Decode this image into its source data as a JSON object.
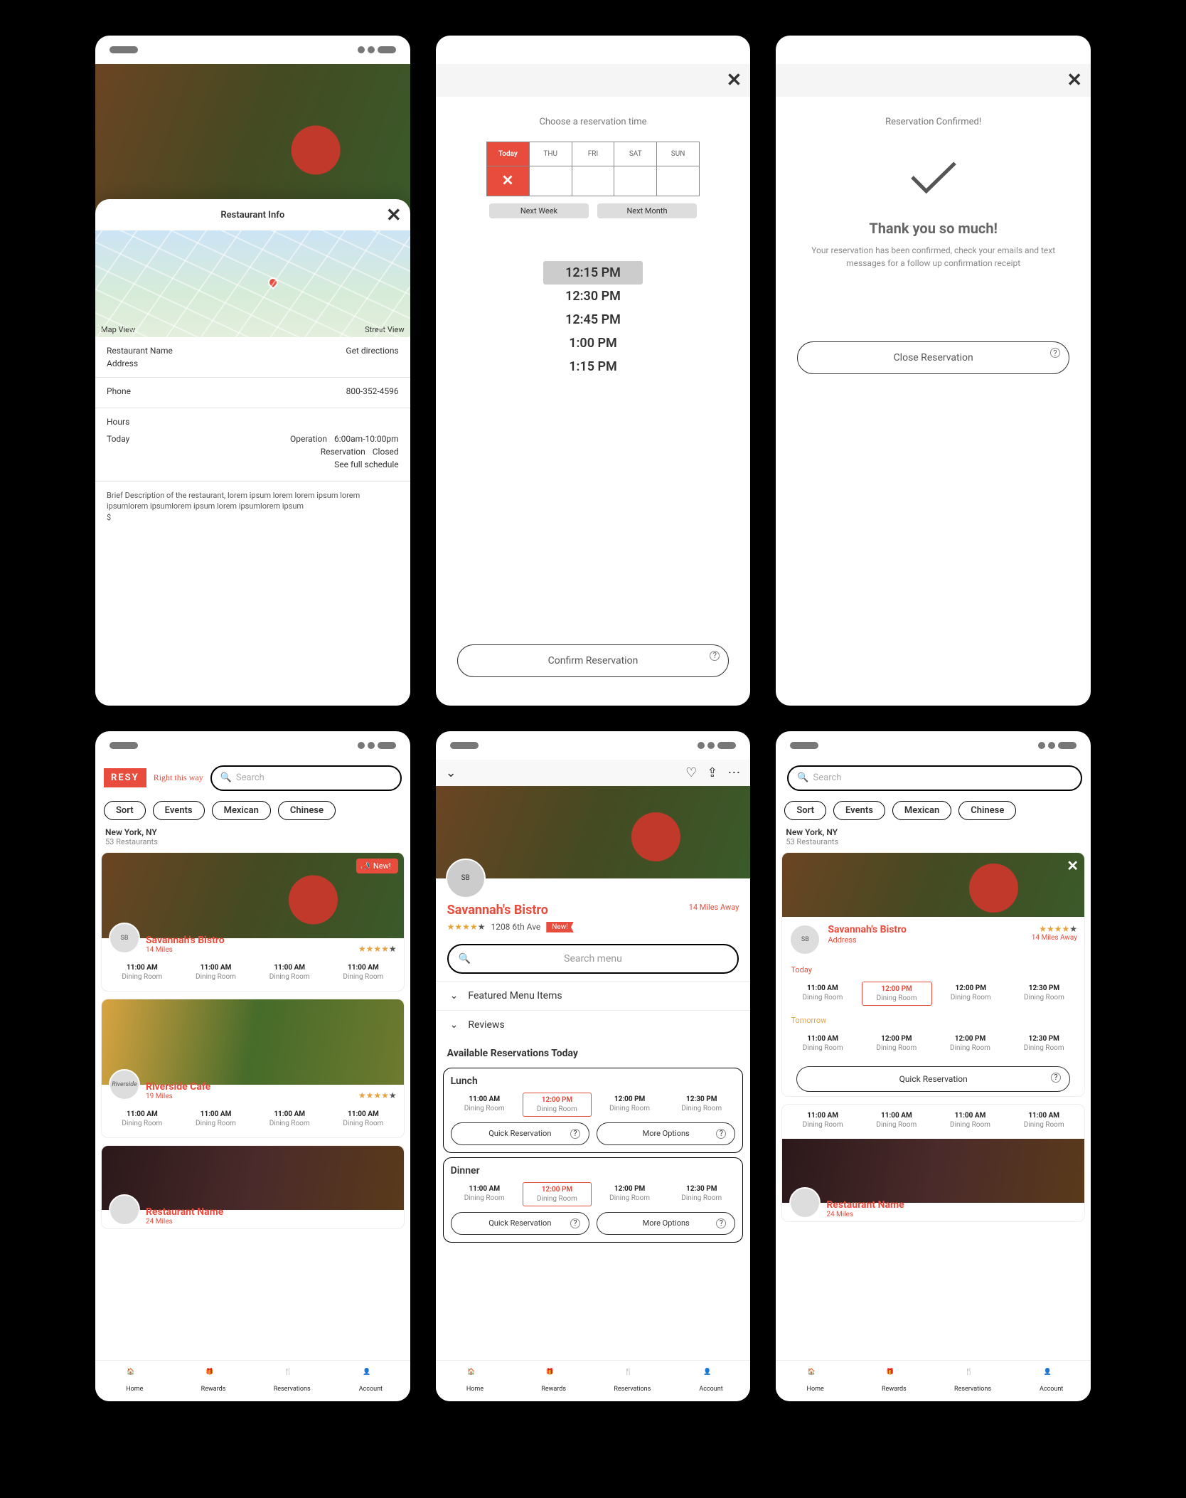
{
  "screen1": {
    "sheet_title": "Restaurant Info",
    "map_view": "Map View",
    "street_view": "Street View",
    "name_label": "Restaurant Name",
    "address_label": "Address",
    "get_directions": "Get directions",
    "phone_label": "Phone",
    "phone_value": "800-352-4596",
    "hours_label": "Hours",
    "today_label": "Today",
    "operation_label": "Operation",
    "operation_value": "6:00am-10:00pm",
    "reservation_label": "Reservation",
    "reservation_value": "Closed",
    "see_full": "See full schedule",
    "description": "Brief Description of the restaurant, lorem ipsum lorem lorem ipsum lorem ipsumlorem ipsumlorem ipsum lorem ipsumlorem ipsum",
    "price": "$"
  },
  "screen2": {
    "title": "Choose a reservation time",
    "days": [
      "Today",
      "THU",
      "FRI",
      "SAT",
      "SUN"
    ],
    "next_week": "Next Week",
    "next_month": "Next Month",
    "times": [
      "12:15 PM",
      "12:30 PM",
      "12:45 PM",
      "1:00 PM",
      "1:15 PM"
    ],
    "confirm": "Confirm Reservation"
  },
  "screen3": {
    "title": "Reservation Confirmed!",
    "heading": "Thank you so much!",
    "body": "Your reservation has been confirmed, check your emails and text messages for a follow up confirmation receipt",
    "close": "Close Reservation"
  },
  "listing": {
    "logo": "RESY",
    "tagline": "Right this way",
    "search_placeholder": "Search",
    "chips": [
      "Sort",
      "Events",
      "Mexican",
      "Chinese"
    ],
    "location": "New York, NY",
    "count": "53 Restaurants",
    "new_badge": "New!",
    "slot_time": "11:00 AM",
    "slot_room": "Dining Room",
    "cards": [
      {
        "name": "Savannah's Bistro",
        "dist": "14 Miles"
      },
      {
        "name": "Riverside Cafe",
        "dist": "19 Miles"
      },
      {
        "name": "Restaurant Name",
        "dist": "24 Miles"
      }
    ]
  },
  "tabs": [
    "Home",
    "Rewards",
    "Reservations",
    "Account"
  ],
  "screen5": {
    "name": "Savannah's Bistro",
    "distance": "14 Miles Away",
    "address": "1208 6th Ave",
    "new": "New!",
    "search_menu": "Search menu",
    "featured": "Featured Menu Items",
    "reviews": "Reviews",
    "avail_title": "Available Reservations Today",
    "meals": [
      "Lunch",
      "Dinner"
    ],
    "slots": [
      {
        "t": "11:00 AM",
        "r": "Dining Room"
      },
      {
        "t": "12:00 PM",
        "r": "Dining Room"
      },
      {
        "t": "12:00 PM",
        "r": "Dining Room"
      },
      {
        "t": "12:30 PM",
        "r": "Dining Room"
      }
    ],
    "quick": "Quick Reservation",
    "more": "More Options"
  },
  "screen6": {
    "name": "Savannah's Bistro",
    "address": "Address",
    "distance": "14 Miles Away",
    "today": "Today",
    "tomorrow": "Tomorrow",
    "slots": [
      {
        "t": "11:00 AM",
        "r": "Dining Room"
      },
      {
        "t": "12:00 PM",
        "r": "Dining Room"
      },
      {
        "t": "12:00 PM",
        "r": "Dining Room"
      },
      {
        "t": "12:30 PM",
        "r": "Dining Room"
      }
    ],
    "quick": "Quick Reservation"
  }
}
